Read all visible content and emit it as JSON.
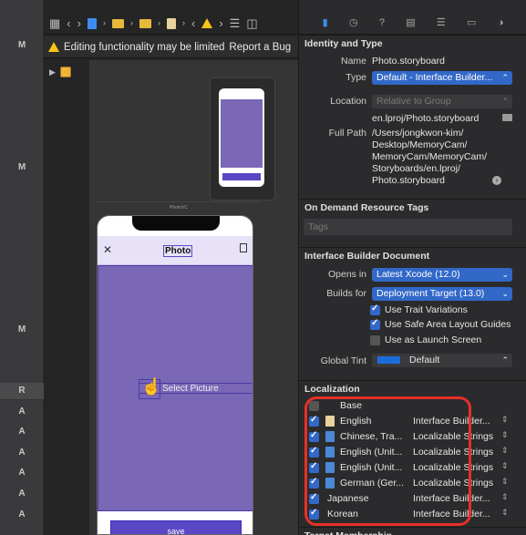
{
  "gutter": {
    "letters": [
      "M",
      "M",
      "M",
      "R",
      "A",
      "A",
      "A",
      "A",
      "A",
      "A"
    ]
  },
  "editor": {
    "jumpbar": {
      "icons": [
        "grid-icon",
        "back-icon",
        "forward-icon",
        "file-icon",
        "folder-icon",
        "folder-icon",
        "storyboard-icon",
        "chevron-left-icon",
        "warning-icon",
        "chevron-right-icon",
        "lines-icon",
        "split-editor-icon"
      ]
    },
    "warning": {
      "text": "Editing functionality may be limited",
      "link": "Report a Bug"
    },
    "scene_label": "PhotoVC",
    "phone": {
      "nav_title": "Photo",
      "select_label": "Select Picture",
      "save_label": "save"
    },
    "colors": {
      "photo_area": "#7a67b6",
      "button": "#5a47c6",
      "navbar": "#e7e2f7"
    }
  },
  "inspector": {
    "tabs": [
      "file-inspector-icon",
      "history-icon",
      "help-icon",
      "identity-icon",
      "attributes-icon",
      "size-icon",
      "connections-icon"
    ],
    "identity": {
      "heading": "Identity and Type",
      "name_label": "Name",
      "name_value": "Photo.storyboard",
      "type_label": "Type",
      "type_value": "Default - Interface Builder...",
      "location_label": "Location",
      "location_value": "Relative to Group",
      "location_file": "en.lproj/Photo.storyboard",
      "fullpath_label": "Full Path",
      "fullpath_lines": [
        "/Users/jongkwon-kim/",
        "Desktop/MemoryCam/",
        "MemoryCam/MemoryCam/",
        "Storyboards/en.lproj/",
        "Photo.storyboard"
      ]
    },
    "on_demand": {
      "heading": "On Demand Resource Tags",
      "placeholder": "Tags"
    },
    "ib_document": {
      "heading": "Interface Builder Document",
      "opens_in_label": "Opens in",
      "opens_in_value": "Latest Xcode (12.0)",
      "builds_for_label": "Builds for",
      "builds_for_value": "Deployment Target (13.0)",
      "options": [
        {
          "label": "Use Trait Variations",
          "checked": true
        },
        {
          "label": "Use Safe Area Layout Guides",
          "checked": true
        },
        {
          "label": "Use as Launch Screen",
          "checked": false
        }
      ],
      "tint_label": "Global Tint",
      "tint_value": "Default",
      "tint_color": "#1a6ed8"
    },
    "localization": {
      "heading": "Localization",
      "rows": [
        {
          "name": "Base",
          "type": "",
          "checked": false,
          "icon": "none"
        },
        {
          "name": "English",
          "type": "Interface Builder...",
          "checked": true,
          "icon": "storyboard"
        },
        {
          "name": "Chinese, Tra...",
          "type": "Localizable Strings",
          "checked": true,
          "icon": "strings"
        },
        {
          "name": "English (Unit...",
          "type": "Localizable Strings",
          "checked": true,
          "icon": "strings"
        },
        {
          "name": "English (Unit...",
          "type": "Localizable Strings",
          "checked": true,
          "icon": "strings"
        },
        {
          "name": "German (Ger...",
          "type": "Localizable Strings",
          "checked": true,
          "icon": "strings"
        },
        {
          "name": "Japanese",
          "type": "Interface Builder...",
          "checked": true,
          "icon": "none"
        },
        {
          "name": "Korean",
          "type": "Interface Builder...",
          "checked": true,
          "icon": "none"
        }
      ]
    },
    "target_heading": "Target Membership",
    "highlight_color": "#e53126"
  }
}
